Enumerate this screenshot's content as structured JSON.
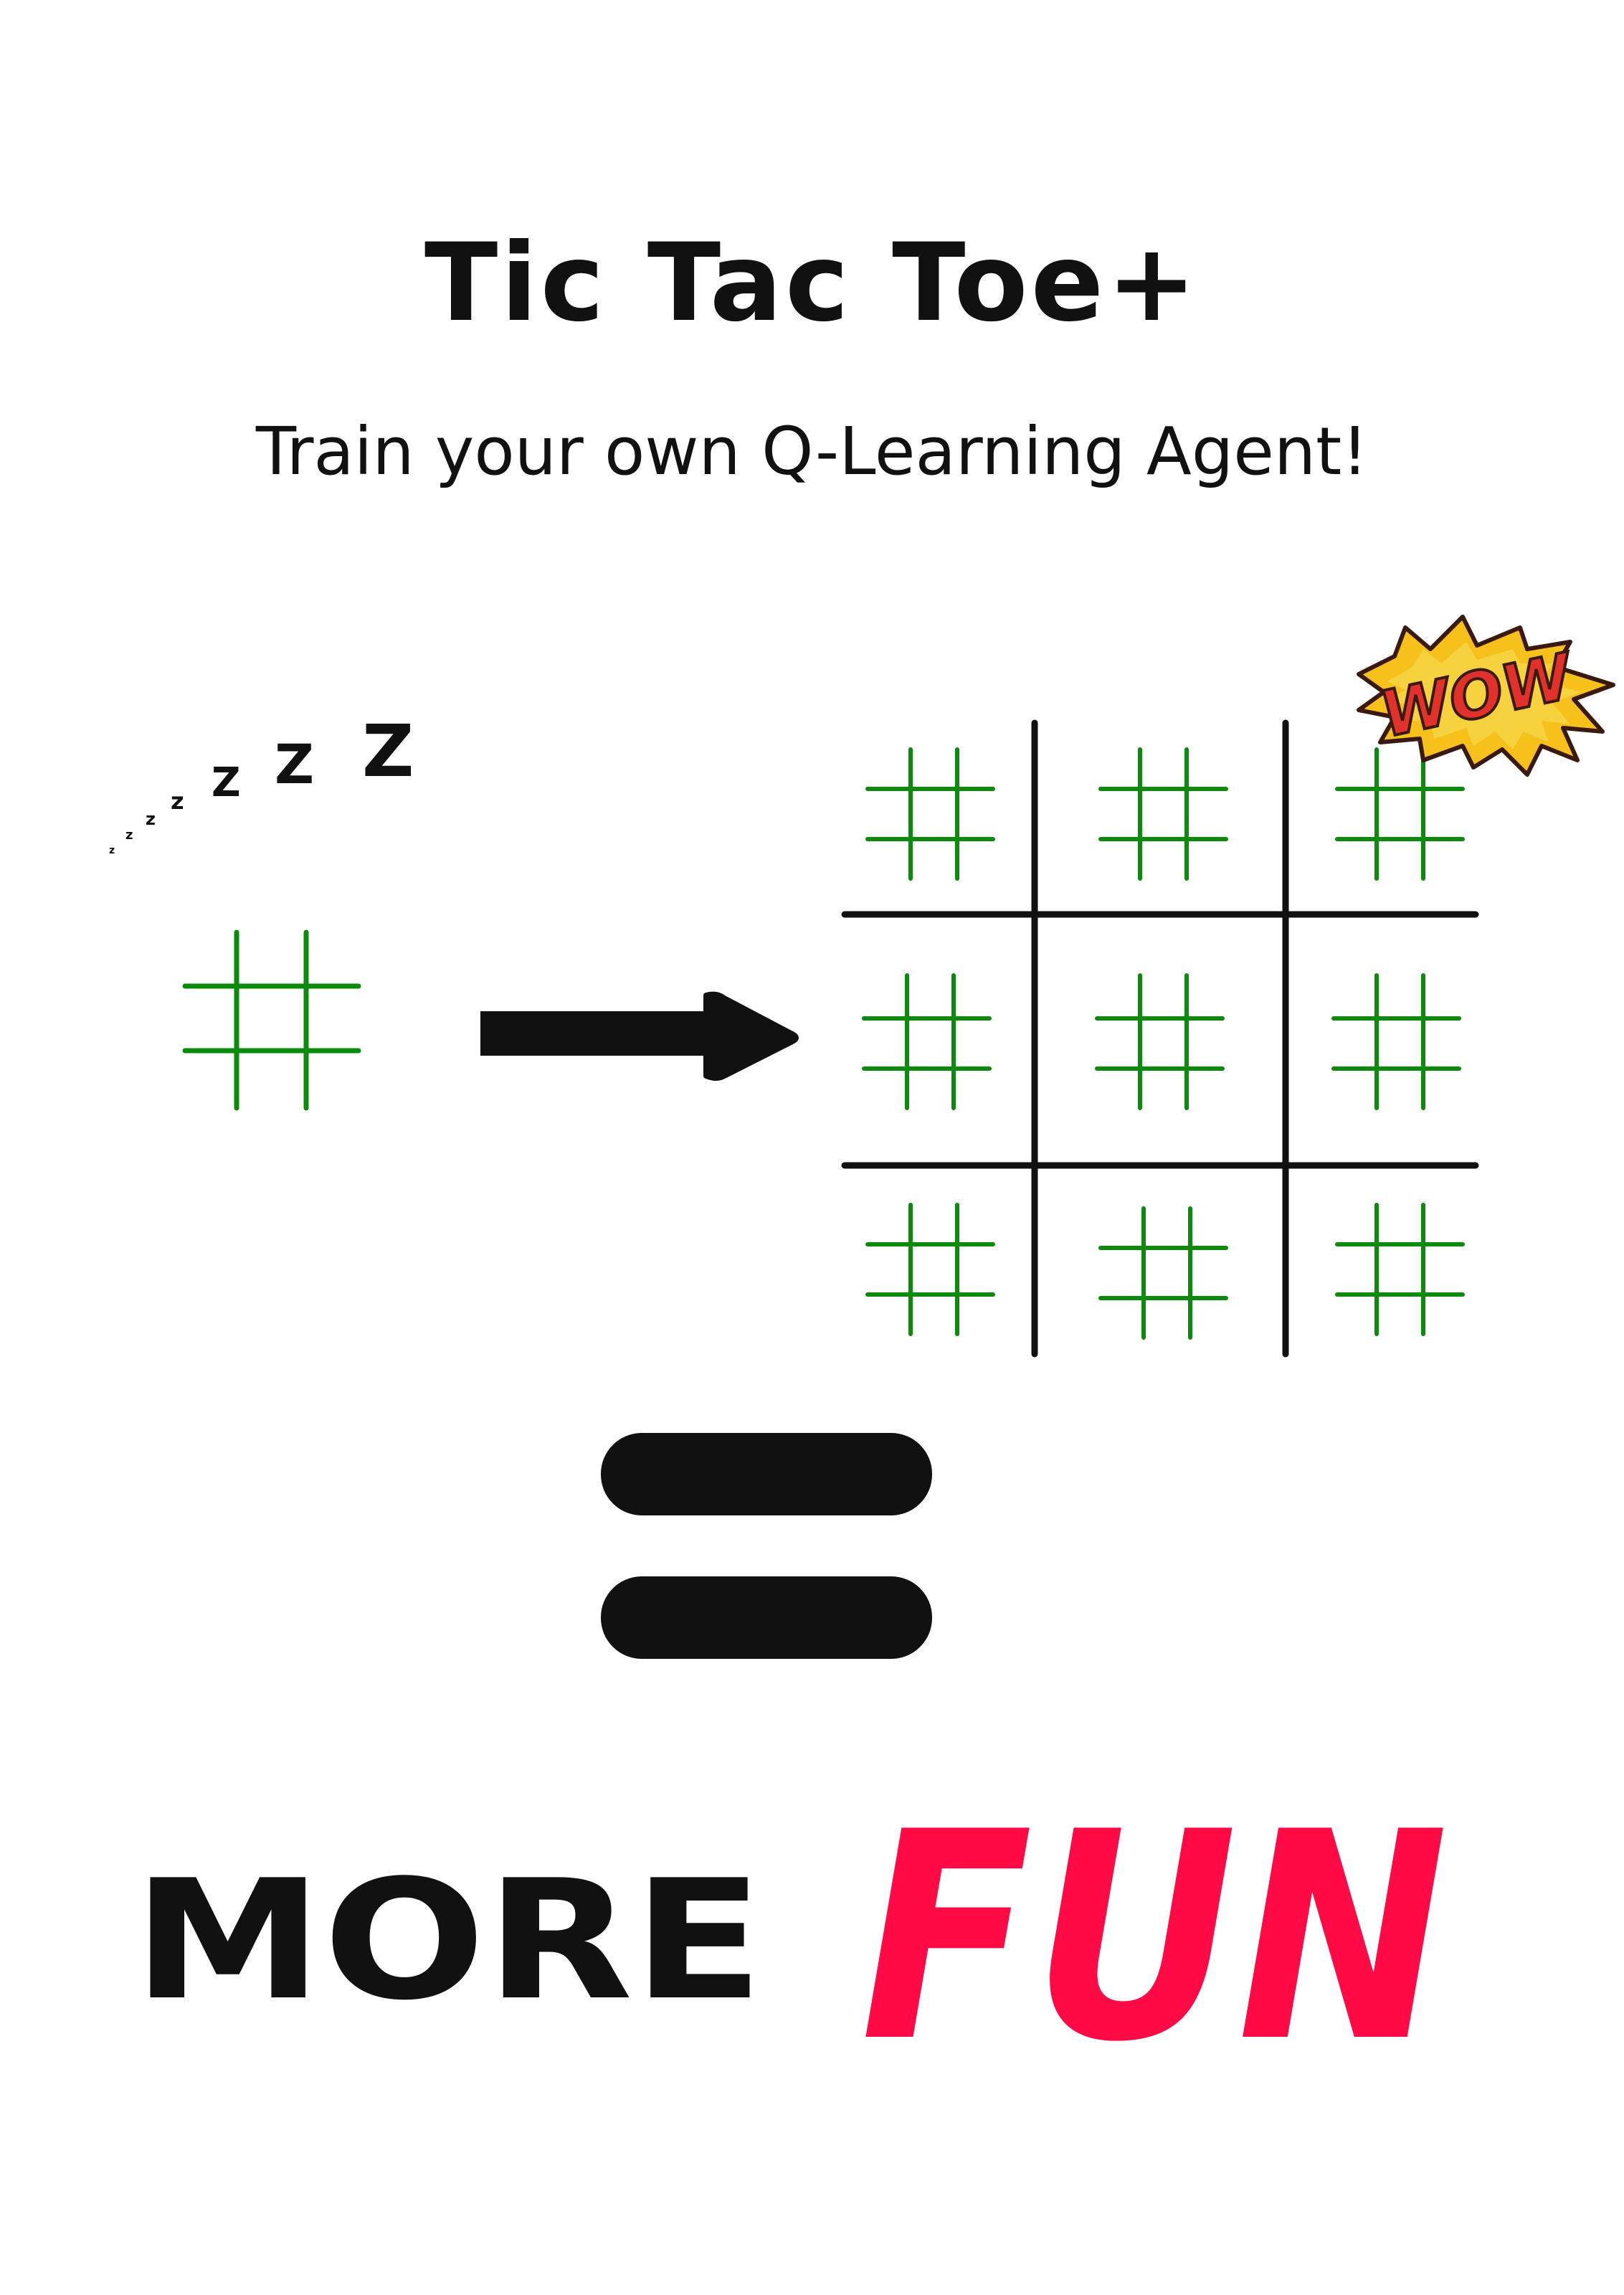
{
  "title": "Tic Tac Toe+",
  "subtitle": "Train your own Q-Learning Agent!",
  "sleep_letters": [
    "z",
    "z",
    "z",
    "z",
    "Z",
    "Z",
    "Z"
  ],
  "wow_label": "WOW",
  "bottom_text": {
    "word_1": "MORE",
    "word_2": "FUN"
  },
  "colors": {
    "grid_small": "#0c8a0c",
    "grid_large": "#111111",
    "fun": "#ff0a45",
    "wow_burst": "#f5c11a",
    "wow_text": "#e0312a"
  },
  "icons": {
    "arrow": "right-arrow-icon",
    "equals": "equals-sign-icon",
    "burst": "comic-burst-icon"
  }
}
